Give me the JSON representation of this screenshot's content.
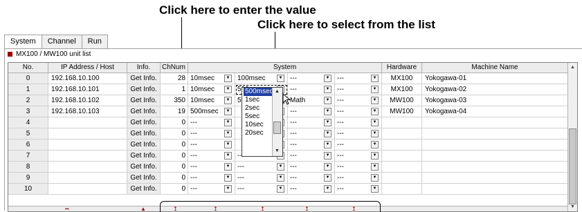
{
  "annotations": {
    "enter_value": "Click here to enter the value",
    "select_list": "Click here to select from the list"
  },
  "tabs": [
    "System",
    "Channel",
    "Run"
  ],
  "unit_list_label": "MX100 / MW100 unit list",
  "headers": {
    "no": "No.",
    "ip": "IP Address / Host",
    "info": "Info.",
    "chnum": "ChNum",
    "system": "System",
    "hardware": "Hardware",
    "machine": "Machine Name"
  },
  "rows": [
    {
      "no": "0",
      "ip": "192.168.10.100",
      "info": "Get Info.",
      "ch": "28",
      "s1": "10msec",
      "s2": "100msec",
      "s3": "---",
      "s4": "---",
      "s5": "---",
      "hw": "MX100",
      "name": "Yokogawa-01"
    },
    {
      "no": "1",
      "ip": "192.168.10.101",
      "info": "Get Info.",
      "ch": "1",
      "s1": "10msec",
      "s2": "500msec",
      "s3": "---",
      "s4": "---",
      "s5": "---",
      "hw": "MX100",
      "name": "Yokogawa-02"
    },
    {
      "no": "2",
      "ip": "192.168.10.102",
      "info": "Get Info.",
      "ch": "350",
      "s1": "10msec",
      "s2": "500msec",
      "s3": "Math",
      "s4": "---",
      "s5": "---",
      "hw": "MW100",
      "name": "Yokogawa-03"
    },
    {
      "no": "3",
      "ip": "192.168.10.103",
      "info": "Get Info.",
      "ch": "19",
      "s1": "500msec",
      "s2": "",
      "s3": "---",
      "s4": "---",
      "s5": "---",
      "hw": "MW100",
      "name": "Yokogawa-04"
    },
    {
      "no": "4",
      "ip": "",
      "info": "Get Info.",
      "ch": "0",
      "s1": "---",
      "s2": "",
      "s3": "---",
      "s4": "---",
      "s5": "---",
      "hw": "",
      "name": ""
    },
    {
      "no": "5",
      "ip": "",
      "info": "Get Info.",
      "ch": "0",
      "s1": "---",
      "s2": "",
      "s3": "---",
      "s4": "---",
      "s5": "---",
      "hw": "",
      "name": ""
    },
    {
      "no": "6",
      "ip": "",
      "info": "Get Info.",
      "ch": "0",
      "s1": "---",
      "s2": "",
      "s3": "---",
      "s4": "---",
      "s5": "---",
      "hw": "",
      "name": ""
    },
    {
      "no": "7",
      "ip": "",
      "info": "Get Info.",
      "ch": "0",
      "s1": "---",
      "s2": "---",
      "s3": "---",
      "s4": "---",
      "s5": "---",
      "hw": "",
      "name": ""
    },
    {
      "no": "8",
      "ip": "",
      "info": "Get Info.",
      "ch": "0",
      "s1": "---",
      "s2": "---",
      "s3": "---",
      "s4": "---",
      "s5": "---",
      "hw": "",
      "name": ""
    },
    {
      "no": "9",
      "ip": "",
      "info": "Get Info.",
      "ch": "0",
      "s1": "---",
      "s2": "---",
      "s3": "---",
      "s4": "---",
      "s5": "---",
      "hw": "",
      "name": ""
    },
    {
      "no": "10",
      "ip": "",
      "info": "Get Info.",
      "ch": "0",
      "s1": "---",
      "s2": "---",
      "s3": "---",
      "s4": "---",
      "s5": "---",
      "hw": "",
      "name": ""
    }
  ],
  "dropdown_options": [
    "1sec",
    "2sec",
    "5sec",
    "10sec",
    "20sec"
  ],
  "dropdown_selected": "500msec",
  "footer_marks": [
    "••",
    "▲",
    "↥",
    "↥",
    "↥",
    "↥",
    "↥"
  ],
  "colors": {
    "unit_marker": "#a00000",
    "highlight": "#1f3f9f"
  }
}
